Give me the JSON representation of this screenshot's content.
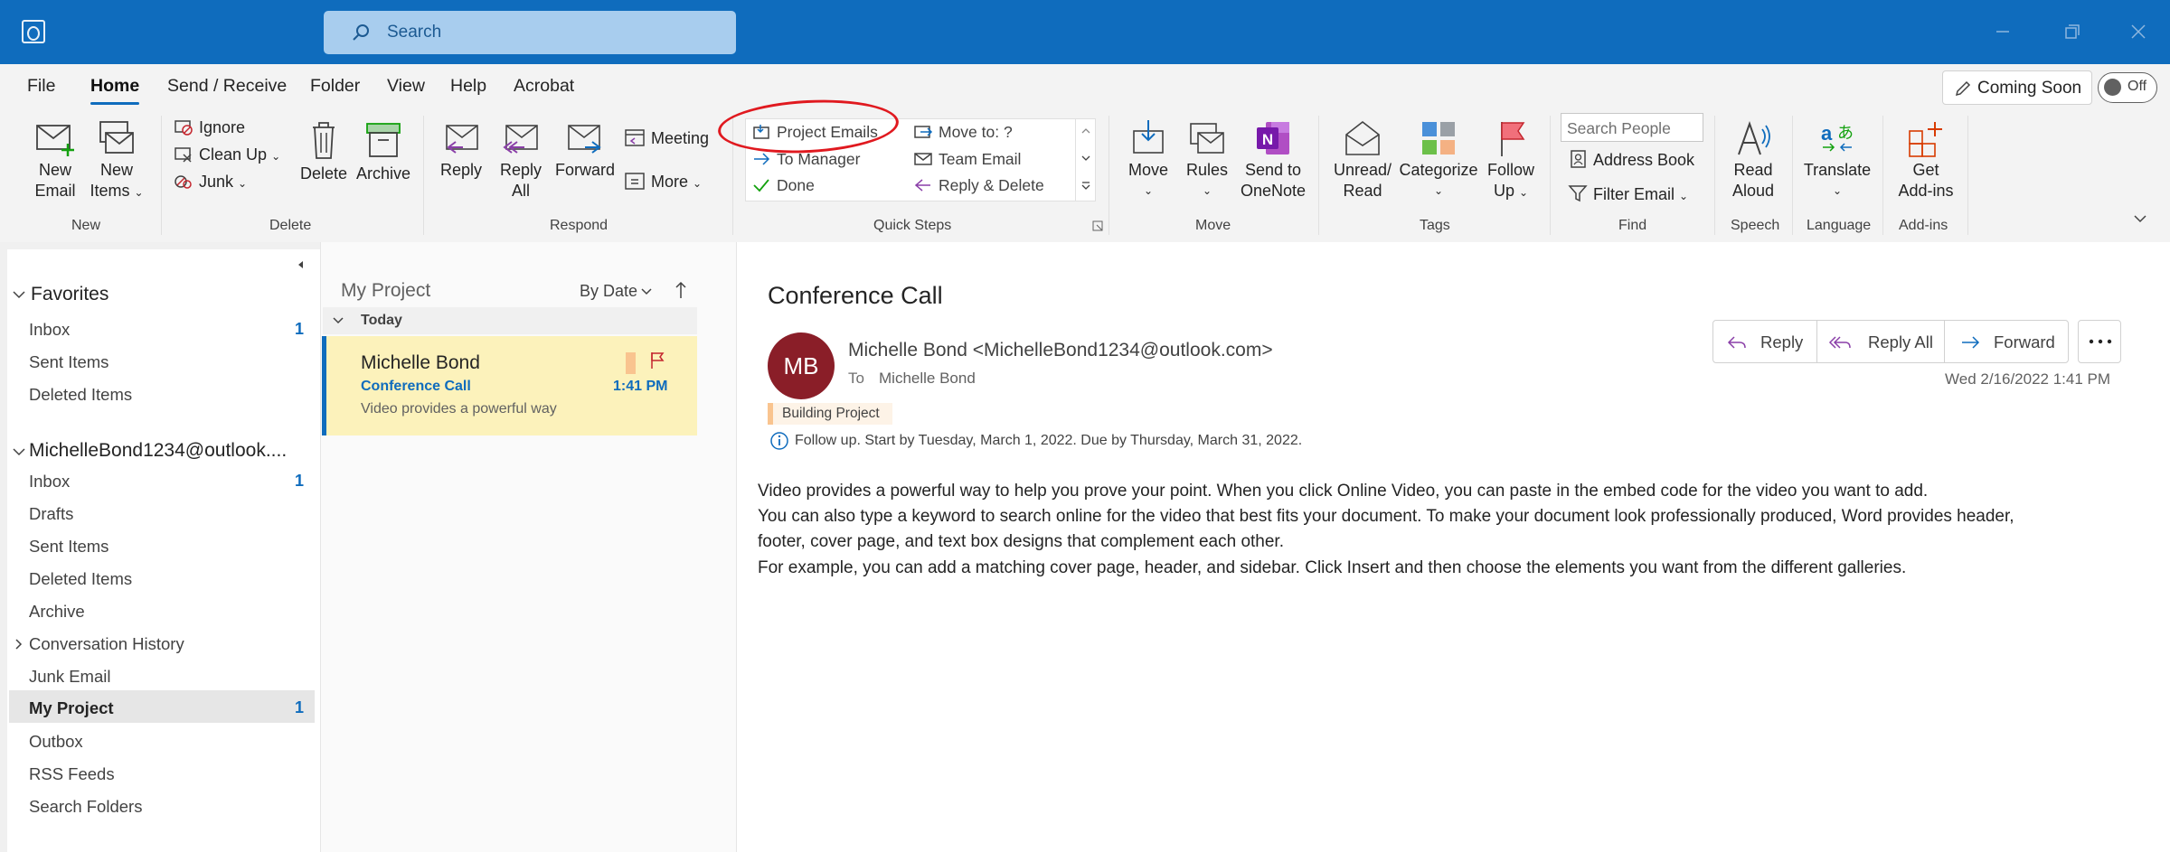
{
  "titlebar": {
    "search_placeholder": "Search"
  },
  "menu": {
    "tabs": [
      "File",
      "Home",
      "Send / Receive",
      "Folder",
      "View",
      "Help",
      "Acrobat"
    ],
    "coming_soon": "Coming Soon",
    "toggle": "Off"
  },
  "ribbon": {
    "new_email": [
      "New",
      "Email"
    ],
    "new_items": [
      "New",
      "Items"
    ],
    "ignore": "Ignore",
    "clean_up": "Clean Up",
    "junk": "Junk",
    "delete": "Delete",
    "archive": "Archive",
    "reply": "Reply",
    "reply_all": [
      "Reply",
      "All"
    ],
    "forward": "Forward",
    "meeting": "Meeting",
    "more": "More",
    "quick_steps": {
      "project_emails": "Project Emails",
      "to_manager": "To Manager",
      "done": "Done",
      "move_to": "Move to: ?",
      "team_email": "Team Email",
      "reply_delete": "Reply & Delete"
    },
    "move": "Move",
    "rules": "Rules",
    "send_onenote": [
      "Send to",
      "OneNote"
    ],
    "unread_read": [
      "Unread/",
      "Read"
    ],
    "categorize": "Categorize",
    "follow_up": [
      "Follow",
      "Up"
    ],
    "search_people": "Search People",
    "address_book": "Address Book",
    "filter_email": "Filter Email",
    "read_aloud": [
      "Read",
      "Aloud"
    ],
    "translate": "Translate",
    "get_addins": [
      "Get",
      "Add-ins"
    ],
    "groups": {
      "new": "New",
      "delete": "Delete",
      "respond": "Respond",
      "quick_steps": "Quick Steps",
      "move": "Move",
      "tags": "Tags",
      "find": "Find",
      "speech": "Speech",
      "language": "Language",
      "addins": "Add-ins"
    }
  },
  "nav": {
    "favorites": "Favorites",
    "fav_items": [
      {
        "label": "Inbox",
        "count": "1"
      },
      {
        "label": "Sent Items"
      },
      {
        "label": "Deleted Items"
      }
    ],
    "account": "MichelleBond1234@outlook....",
    "items": [
      {
        "label": "Inbox",
        "count": "1"
      },
      {
        "label": "Drafts"
      },
      {
        "label": "Sent Items"
      },
      {
        "label": "Deleted Items"
      },
      {
        "label": "Archive"
      },
      {
        "label": "Conversation History"
      },
      {
        "label": "Junk Email"
      },
      {
        "label": "My Project",
        "count": "1"
      },
      {
        "label": "Outbox"
      },
      {
        "label": "RSS Feeds"
      },
      {
        "label": "Search Folders"
      }
    ]
  },
  "list": {
    "folder": "My Project",
    "sort": "By Date",
    "group": "Today",
    "message": {
      "sender": "Michelle Bond",
      "subject": "Conference Call",
      "time": "1:41 PM",
      "preview": "Video provides a powerful way"
    }
  },
  "reading": {
    "subject": "Conference Call",
    "initials": "MB",
    "from": "Michelle Bond <MichelleBond1234@outlook.com>",
    "to_label": "To",
    "to": "Michelle Bond",
    "category": "Building Project",
    "followup": "Follow up.  Start by Tuesday, March 1, 2022.  Due by Thursday, March 31, 2022.",
    "date": "Wed 2/16/2022 1:41 PM",
    "actions": {
      "reply": "Reply",
      "reply_all": "Reply All",
      "forward": "Forward"
    },
    "body": [
      "Video provides a powerful way to help you prove your point. When you click Online Video, you can paste in the embed code for the video you want to add.",
      "You can also type a keyword to search online for the video that best fits your document. To make your document look professionally produced, Word provides header,",
      "footer, cover page, and text box designs that complement each other.",
      "For example, you can add a matching cover page, header, and sidebar. Click Insert and then choose the elements you want from the different galleries."
    ]
  },
  "colors": {
    "accent": "#0f6cbd",
    "selected_message": "#fcf2bb",
    "avatar": "#8a1e28",
    "highlight": "#e0191f"
  }
}
